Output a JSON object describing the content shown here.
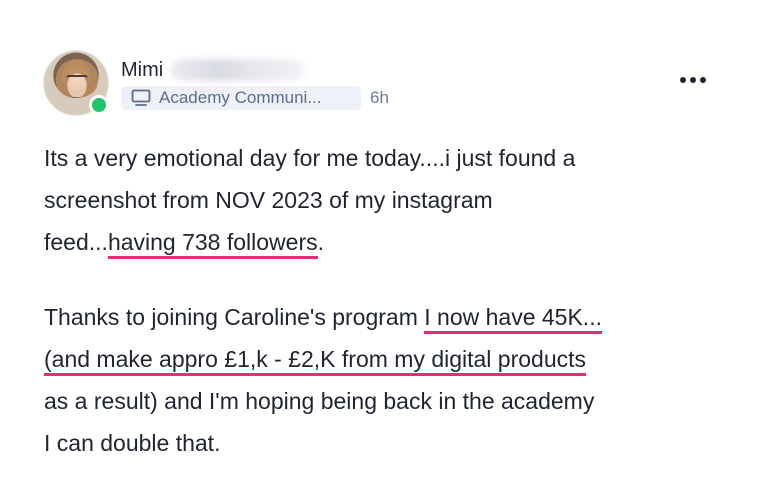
{
  "post": {
    "author": {
      "name": "Mimi",
      "name_obscured": true,
      "online": true
    },
    "community": {
      "label": "Academy Communi...",
      "icon": "monitor-icon"
    },
    "time_ago": "6h",
    "more_icon": "more-horizontal-icon",
    "paragraph1": {
      "line1": "Its a very emotional day for me today....i just found a",
      "line2": "screenshot from NOV 2023 of my instagram",
      "line3_before": "feed...",
      "line3_highlight": "having 738 followers",
      "line3_after": "."
    },
    "paragraph2": {
      "line1_before": "Thanks to joining Caroline's program ",
      "line1_highlight": "I now have 45K...",
      "line2_highlight": "(and make appro £1,k - £2,K from my digital products",
      "line3": "as a result) and I'm hoping being back in the academy",
      "line4": "I can double that."
    },
    "highlight_color": "#ea2b78",
    "online_color": "#21c36b"
  }
}
